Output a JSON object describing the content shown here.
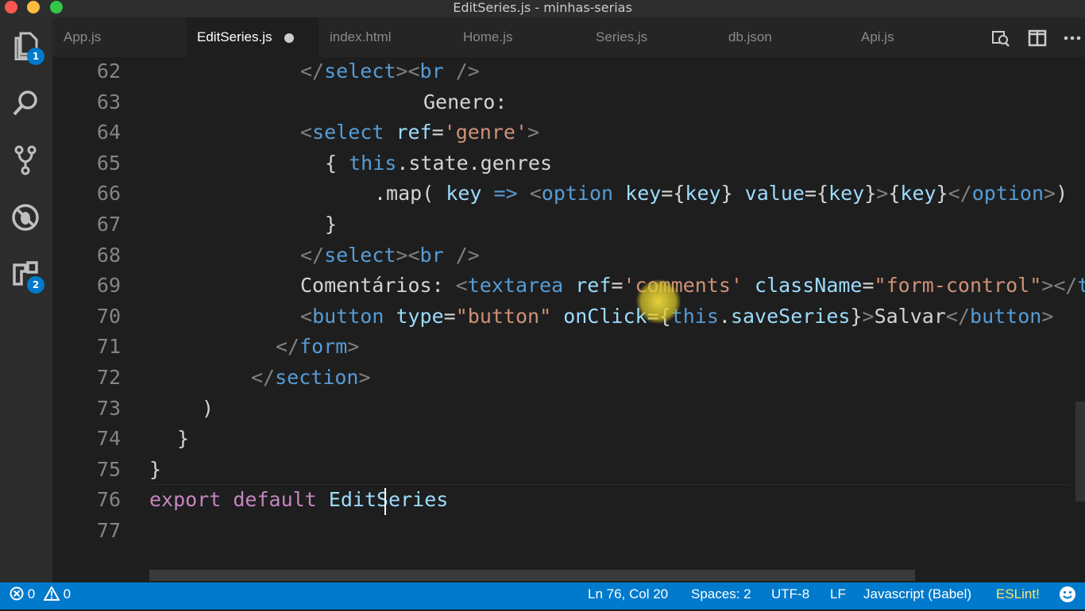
{
  "window": {
    "title": "EditSeries.js - minhas-serias",
    "zoom": "1.50"
  },
  "activity_bar": {
    "explorer_badge": "1",
    "extensions_badge": "2"
  },
  "tabs": [
    {
      "label": "App.js"
    },
    {
      "label": "EditSeries.js"
    },
    {
      "label": "index.html"
    },
    {
      "label": "Home.js"
    },
    {
      "label": "Series.js"
    },
    {
      "label": "db.json"
    },
    {
      "label": "Api.js"
    }
  ],
  "editor": {
    "lines": [
      {
        "num": "62",
        "tokens": [
          [
            "tg",
            "</"
          ],
          [
            "tn",
            "select"
          ],
          [
            "tg",
            "><"
          ],
          [
            "tn",
            "br"
          ],
          [
            "tg",
            " />"
          ]
        ]
      },
      {
        "num": "63",
        "tokens": [
          [
            "pl",
            "Genero:"
          ]
        ]
      },
      {
        "num": "64",
        "tokens": [
          [
            "tg",
            "<"
          ],
          [
            "tn",
            "select"
          ],
          [
            "pl",
            " "
          ],
          [
            "at",
            "ref"
          ],
          [
            "pl",
            "="
          ],
          [
            "st",
            "'genre'"
          ],
          [
            "tg",
            ">"
          ]
        ]
      },
      {
        "num": "65",
        "tokens": [
          [
            "pl",
            "{ "
          ],
          [
            "tn",
            "this"
          ],
          [
            "pl",
            ".state.genres"
          ]
        ]
      },
      {
        "num": "66",
        "tokens": [
          [
            "pl",
            ".map( "
          ],
          [
            "id",
            "key"
          ],
          [
            "pl",
            " "
          ],
          [
            "tn",
            "=>"
          ],
          [
            "pl",
            " "
          ],
          [
            "tg",
            "<"
          ],
          [
            "tn",
            "option"
          ],
          [
            "pl",
            " "
          ],
          [
            "at",
            "key"
          ],
          [
            "pl",
            "={"
          ],
          [
            "id",
            "key"
          ],
          [
            "pl",
            "} "
          ],
          [
            "at",
            "value"
          ],
          [
            "pl",
            "={"
          ],
          [
            "id",
            "key"
          ],
          [
            "pl",
            "}"
          ],
          [
            "tg",
            ">"
          ],
          [
            "pl",
            "{"
          ],
          [
            "id",
            "key"
          ],
          [
            "pl",
            "}"
          ],
          [
            "tg",
            "</"
          ],
          [
            "tn",
            "option"
          ],
          [
            "tg",
            ">"
          ],
          [
            "pl",
            ")"
          ]
        ]
      },
      {
        "num": "67",
        "tokens": [
          [
            "pl",
            "}"
          ]
        ]
      },
      {
        "num": "68",
        "tokens": [
          [
            "tg",
            "</"
          ],
          [
            "tn",
            "select"
          ],
          [
            "tg",
            "><"
          ],
          [
            "tn",
            "br"
          ],
          [
            "tg",
            " />"
          ]
        ]
      },
      {
        "num": "69",
        "tokens": [
          [
            "pl",
            "Comentários: "
          ],
          [
            "tg",
            "<"
          ],
          [
            "tn",
            "textarea"
          ],
          [
            "pl",
            " "
          ],
          [
            "at",
            "ref"
          ],
          [
            "pl",
            "="
          ],
          [
            "st",
            "'comments'"
          ],
          [
            "pl",
            " "
          ],
          [
            "at",
            "className"
          ],
          [
            "pl",
            "="
          ],
          [
            "st",
            "\"form-control\""
          ],
          [
            "tg",
            "></"
          ],
          [
            "tn",
            "t"
          ]
        ]
      },
      {
        "num": "70",
        "tokens": [
          [
            "tg",
            "<"
          ],
          [
            "tn",
            "button"
          ],
          [
            "pl",
            " "
          ],
          [
            "at",
            "type"
          ],
          [
            "pl",
            "="
          ],
          [
            "st",
            "\"button\""
          ],
          [
            "pl",
            " "
          ],
          [
            "at",
            "onClick"
          ],
          [
            "pl",
            "={"
          ],
          [
            "tn",
            "this"
          ],
          [
            "pl",
            "."
          ],
          [
            "id",
            "saveSeries"
          ],
          [
            "pl",
            "}"
          ],
          [
            "tg",
            ">"
          ],
          [
            "pl",
            "Salvar"
          ],
          [
            "tg",
            "</"
          ],
          [
            "tn",
            "button"
          ],
          [
            "tg",
            ">"
          ]
        ]
      },
      {
        "num": "71",
        "tokens": [
          [
            "tg",
            "</"
          ],
          [
            "tn",
            "form"
          ],
          [
            "tg",
            ">"
          ]
        ]
      },
      {
        "num": "72",
        "tokens": [
          [
            "tg",
            "</"
          ],
          [
            "tn",
            "section"
          ],
          [
            "tg",
            ">"
          ]
        ]
      },
      {
        "num": "73",
        "tokens": [
          [
            "pl",
            ")"
          ]
        ]
      },
      {
        "num": "74",
        "tokens": [
          [
            "pl",
            "}"
          ]
        ]
      },
      {
        "num": "75",
        "tokens": [
          [
            "pl",
            "}"
          ]
        ]
      },
      {
        "num": "76",
        "tokens": [
          [
            "kw",
            "export"
          ],
          [
            "pl",
            " "
          ],
          [
            "kw",
            "default"
          ],
          [
            "pl",
            " "
          ],
          [
            "id",
            "EditSeries"
          ]
        ]
      },
      {
        "num": "77",
        "tokens": []
      }
    ]
  },
  "status_bar": {
    "errors": "0",
    "warnings": "0",
    "position": "Ln 76, Col 20",
    "spaces": "Spaces: 2",
    "encoding": "UTF-8",
    "eol": "LF",
    "language": "Javascript (Babel)",
    "eslint": "ESLint!"
  },
  "colors": {
    "accent": "#007acc",
    "tag": "#569cd6",
    "string": "#ce9178",
    "keyword": "#c586c0",
    "attribute": "#9cdcfe"
  }
}
